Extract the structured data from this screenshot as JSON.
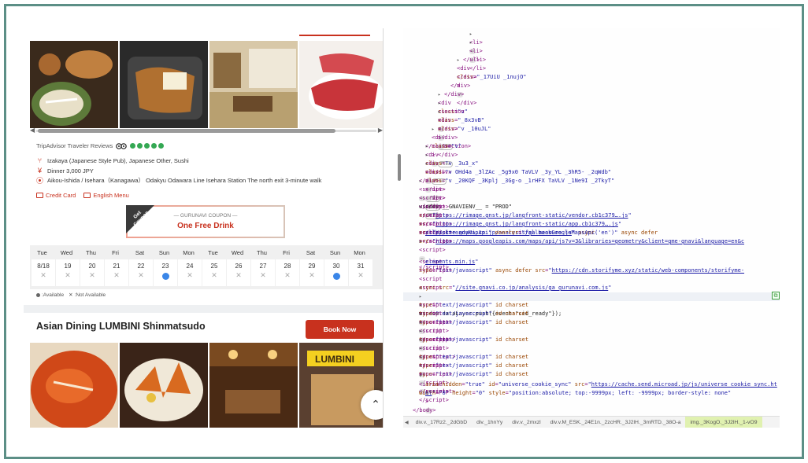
{
  "listing1": {
    "tripadvisor_label": "TripAdvisor Traveler Reviews",
    "rating_dots": 5,
    "category": "Izakaya (Japanese Style Pub), Japanese Other, Sushi",
    "price": "Dinner 3,000 JPY",
    "location": "Aikou-Ishida / Isehara（Kanagawa） Odakyu Odawara Line Isehara Station The north exit 3-minute walk",
    "tag_credit": "Credit Card",
    "tag_english": "English Menu",
    "coupon_get": "Get Coupon",
    "coupon_label": "— GURUNAVI COUPON —",
    "coupon_title": "One Free Drink"
  },
  "calendar": {
    "weekdays": [
      "Tue",
      "Wed",
      "Thu",
      "Fri",
      "Sat",
      "Sun",
      "Mon",
      "Tue",
      "Wed",
      "Thu",
      "Fri",
      "Sat",
      "Sun",
      "Mon"
    ],
    "days": [
      {
        "label": "8/18",
        "available": false
      },
      {
        "label": "19",
        "available": false
      },
      {
        "label": "20",
        "available": false
      },
      {
        "label": "21",
        "available": false
      },
      {
        "label": "22",
        "available": false
      },
      {
        "label": "23",
        "available": true
      },
      {
        "label": "24",
        "available": false
      },
      {
        "label": "25",
        "available": false
      },
      {
        "label": "26",
        "available": false
      },
      {
        "label": "27",
        "available": false
      },
      {
        "label": "28",
        "available": false
      },
      {
        "label": "29",
        "available": false
      },
      {
        "label": "30",
        "available": true
      },
      {
        "label": "31",
        "available": false
      }
    ],
    "legend_available": ":Available",
    "legend_not_available": ":Not Available"
  },
  "listing2": {
    "title": "Asian Dining LUMBINI Shinmatsudo",
    "book_label": "Book Now"
  },
  "devtools": {
    "breadcrumbs": [
      "div.v._17Rz2._2dGbD",
      "div._1hnYy",
      "div.v._2mxzl",
      "div.v.M_ESK._24E1n._2zcHR._3J2lH._3mRTD._38O-a",
      "img._3KogO._3J2lH._1-vO9"
    ]
  },
  "colors": {
    "accent": "#c8311e",
    "frame": "#5c8f86",
    "available": "#3a86e8",
    "rating": "#34a853"
  }
}
